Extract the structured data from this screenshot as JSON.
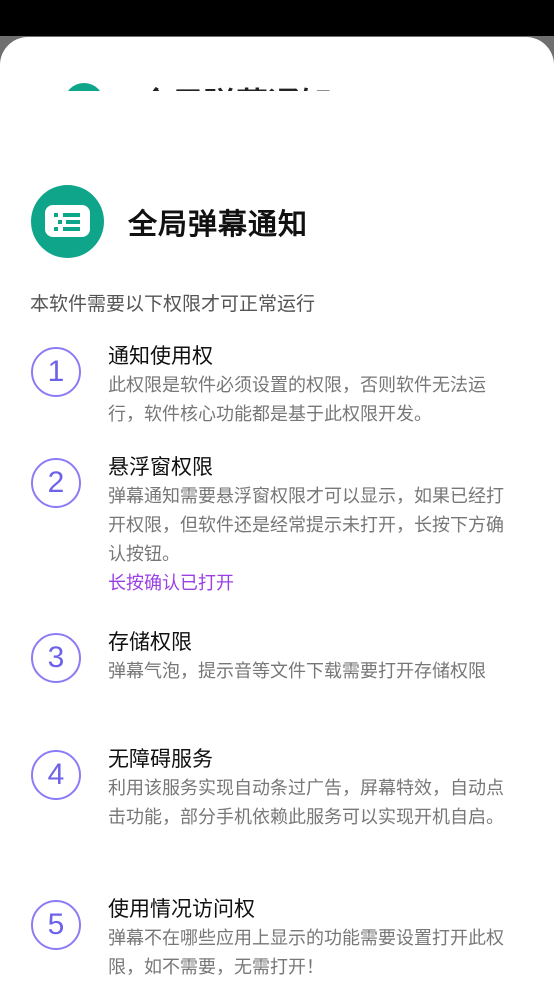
{
  "peek_title": "全局弹幕通知",
  "app": {
    "title": "全局弹幕通知",
    "icon": "danmaku-message-icon",
    "accent_color": "#0fa58b"
  },
  "subtitle": "本软件需要以下权限才可正常运行",
  "permissions": [
    {
      "number": "1",
      "title": "通知使用权",
      "desc": "此权限是软件必须设置的权限，否则软件无法运行，软件核心功能都是基于此权限开发。",
      "link": ""
    },
    {
      "number": "2",
      "title": "悬浮窗权限",
      "desc": "弹幕通知需要悬浮窗权限才可以显示，如果已经打开权限，但软件还是经常提示未打开，长按下方确认按钮。",
      "link": "长按确认已打开"
    },
    {
      "number": "3",
      "title": "存储权限",
      "desc": "弹幕气泡，提示音等文件下载需要打开存储权限",
      "link": ""
    },
    {
      "number": "4",
      "title": "无障碍服务",
      "desc": "利用该服务实现自动条过广告，屏幕特效，自动点击功能，部分手机依赖此服务可以实现开机自启。",
      "link": ""
    },
    {
      "number": "5",
      "title": "使用情况访问权",
      "desc": "弹幕不在哪些应用上显示的功能需要设置打开此权限，如不需要，无需打开！",
      "link": ""
    }
  ],
  "colors": {
    "number_ring": "#8b7cf6",
    "link": "#9b3fe4"
  }
}
